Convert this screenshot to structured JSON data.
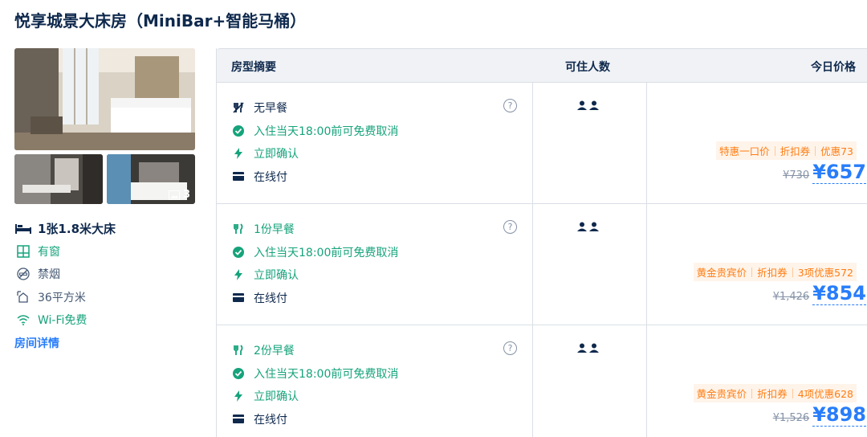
{
  "room": {
    "title": "悦享城景大床房（MiniBar+智能马桶）",
    "photo_count": "3",
    "facilities": [
      {
        "icon": "bed-icon",
        "text": "1张1.8米大床"
      },
      {
        "icon": "window-icon",
        "text": "有窗"
      },
      {
        "icon": "no-smoking-icon",
        "text": "禁烟"
      },
      {
        "icon": "area-icon",
        "text": "36平方米"
      },
      {
        "icon": "wifi-icon",
        "text": "Wi-Fi免费"
      }
    ],
    "detail_link": "房间详情"
  },
  "table": {
    "headers": {
      "summary": "房型摘要",
      "guests": "可住人数",
      "price": "今日价格"
    },
    "rows": [
      {
        "meal": "无早餐",
        "cancel": "入住当天18:00前可免费取消",
        "confirm": "立即确认",
        "pay": "在线付",
        "help": "?",
        "promo": [
          "特惠一口价",
          "折扣券",
          "优惠73"
        ],
        "original_price": "¥730",
        "price": "¥657"
      },
      {
        "meal": "1份早餐",
        "cancel": "入住当天18:00前可免费取消",
        "confirm": "立即确认",
        "pay": "在线付",
        "help": "?",
        "promo": [
          "黄金贵宾价",
          "折扣券",
          "3项优惠572"
        ],
        "original_price": "¥1,426",
        "price": "¥854"
      },
      {
        "meal": "2份早餐",
        "cancel": "入住当天18:00前可免费取消",
        "confirm": "立即确认",
        "pay": "在线付",
        "help": "?",
        "promo": [
          "黄金贵宾价",
          "折扣券",
          "4项优惠628"
        ],
        "original_price": "¥1,526",
        "price": "¥898"
      }
    ]
  },
  "colors": {
    "title": "#0f294d",
    "green": "#16a37b",
    "blue": "#287dfa",
    "orange": "#ff7d13",
    "header_bg": "#f0f2f5"
  }
}
